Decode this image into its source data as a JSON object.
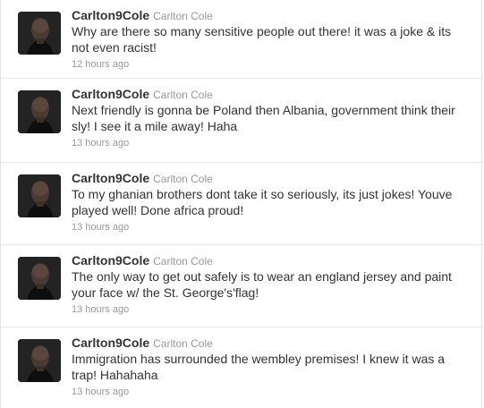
{
  "tweets": [
    {
      "screen_name": "Carlton9Cole",
      "full_name": "Carlton Cole",
      "text": "Why are there so many sensitive people out there! it was a joke & its not even racist!",
      "time": "12 hours ago"
    },
    {
      "screen_name": "Carlton9Cole",
      "full_name": "Carlton Cole",
      "text": "Next friendly is gonna be Poland then Albania, government think their sly! I see it a mile away! Haha",
      "time": "13 hours ago"
    },
    {
      "screen_name": "Carlton9Cole",
      "full_name": "Carlton Cole",
      "text": "To my ghanian brothers dont take it so seriously, its just jokes! Youve played well! Done africa proud!",
      "time": "13 hours ago"
    },
    {
      "screen_name": "Carlton9Cole",
      "full_name": "Carlton Cole",
      "text": "The only way to get out safely is to wear an england jersey and paint your face w/ the St. George's'flag!",
      "time": "13 hours ago"
    },
    {
      "screen_name": "Carlton9Cole",
      "full_name": "Carlton Cole",
      "text": "Immigration has surrounded the wembley premises! I knew it was a trap! Hahahaha",
      "time": "13 hours ago"
    }
  ],
  "avatar_icon": "profile-photo"
}
